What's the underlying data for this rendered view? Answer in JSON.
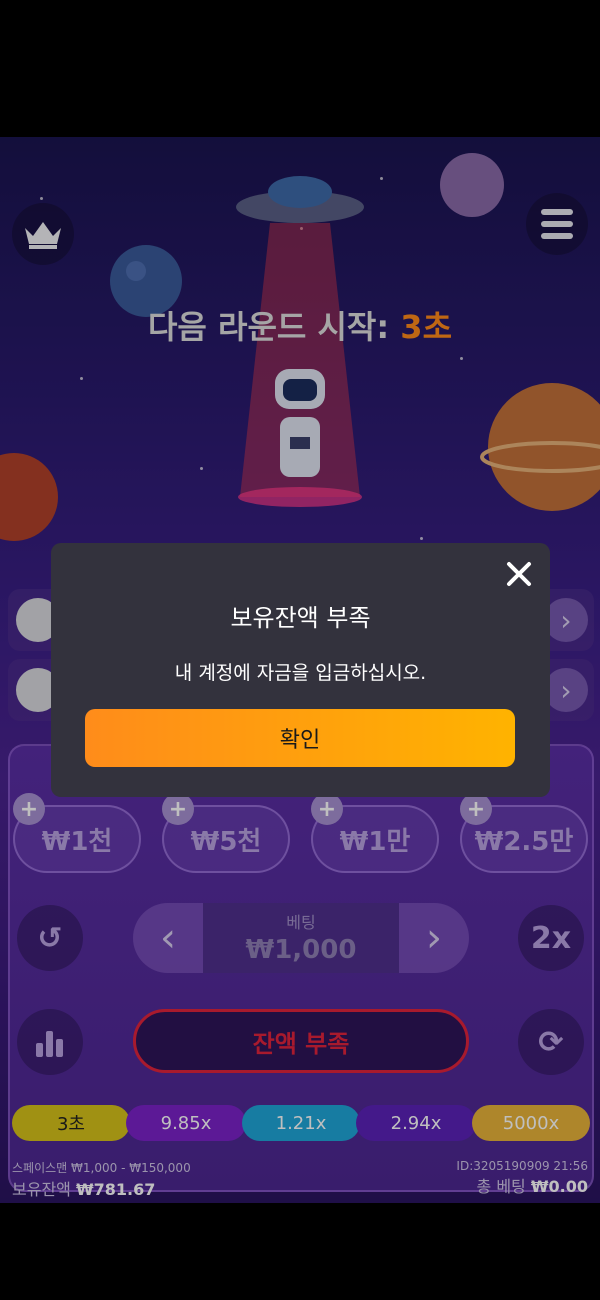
{
  "header": {
    "crown_icon": "crown-icon",
    "menu_icon": "hamburger-menu-icon"
  },
  "countdown": {
    "label": "다음 라운드 시작: ",
    "value": "3초"
  },
  "chips": [
    {
      "label": "₩1천"
    },
    {
      "label": "₩5천"
    },
    {
      "label": "₩1만"
    },
    {
      "label": "₩2.5만"
    }
  ],
  "bet": {
    "label": "베팅",
    "value": "₩1,000"
  },
  "multiplier_button": "2x",
  "action_button": "잔액 부족",
  "history": [
    {
      "label": "3초",
      "color": "#d6c21a"
    },
    {
      "label": "9.85x",
      "color": "#7b22c9"
    },
    {
      "label": "1.21x",
      "color": "#1fa6d8"
    },
    {
      "label": "2.94x",
      "color": "#5b22b8"
    },
    {
      "label": "5000x",
      "color": "#e8b33a"
    }
  ],
  "footer": {
    "game_name": "스페이스맨",
    "range": "₩1,000 - ₩150,000",
    "balance_label": "보유잔액",
    "balance_value": "₩781.67",
    "id_time": "ID:3205190909  21:56",
    "total_bet_label": "총 베팅",
    "total_bet_value": "₩0.00"
  },
  "modal": {
    "title": "보유잔액 부족",
    "message": "내 계정에 자금을 입금하십시오.",
    "confirm": "확인"
  },
  "colors": {
    "accent": "#ff8a1a",
    "danger": "#e0233d"
  }
}
